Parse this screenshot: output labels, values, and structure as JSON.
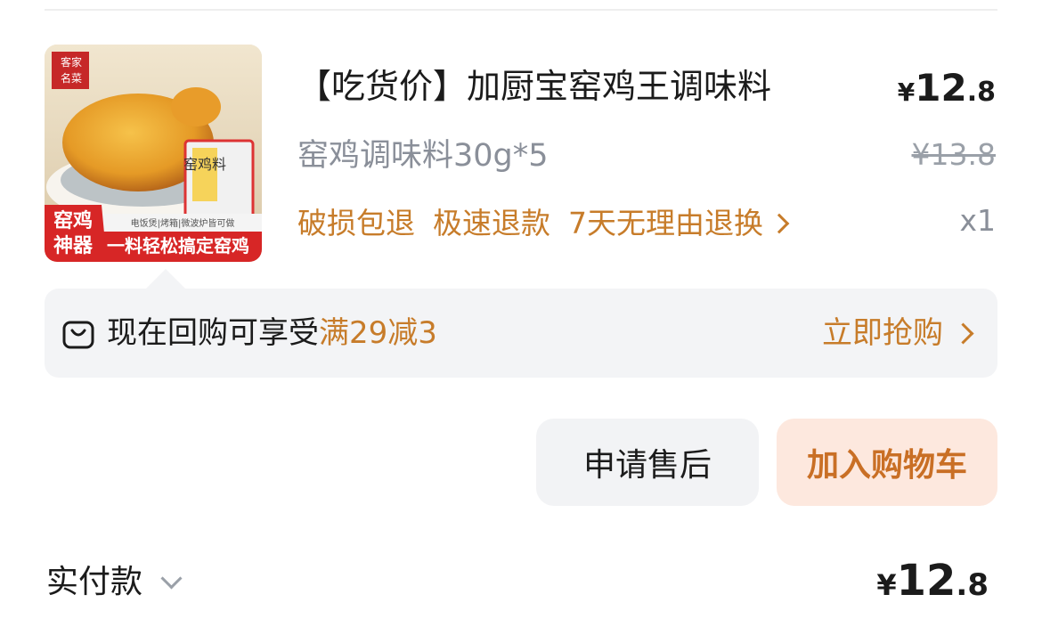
{
  "product": {
    "title": "【吃货价】加厨宝窑鸡王调味料",
    "spec": "窑鸡调味料30g*5",
    "price": {
      "symbol": "¥",
      "integer": "12",
      "decimal": ".8"
    },
    "original_price": "¥13.8",
    "quantity": "x1",
    "services": [
      "破损包退",
      "极速退款",
      "7天无理由退换"
    ],
    "image": {
      "description_icon": "roast-chicken-product-photo",
      "brand_badge": "客家名菜",
      "badge_text": "窑鸡神器",
      "banner_text": "一料轻松搞定窑鸡",
      "sub_text": "电饭煲|烤箱|微波炉皆可做",
      "package_text": "窑鸡料"
    }
  },
  "promo": {
    "icon": "shopping-bag-icon",
    "text_prefix": "现在回购可享受",
    "highlight": "满29减3",
    "cta": "立即抢购"
  },
  "actions": {
    "after_sale": "申请售后",
    "add_to_cart": "加入购物车"
  },
  "payment": {
    "label": "实付款",
    "amount": {
      "symbol": "¥",
      "integer": "12",
      "decimal": ".8"
    }
  },
  "colors": {
    "accent": "#c77c2a",
    "cart_bg": "#fde8de",
    "muted": "#8a8f99",
    "panel": "#f3f4f6"
  }
}
